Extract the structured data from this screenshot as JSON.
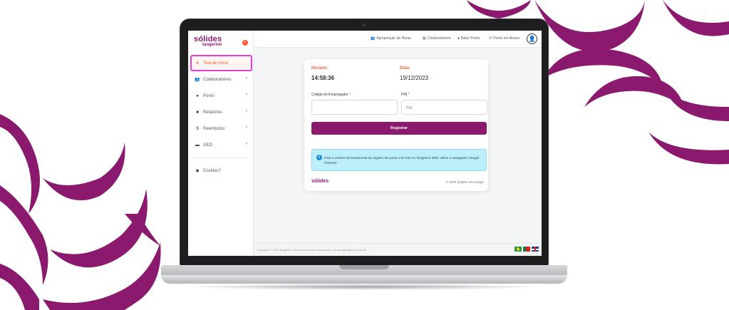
{
  "colors": {
    "brand": "#8b1a6f",
    "accent": "#ff5a36",
    "active_border": "#e53dd8",
    "alert_bg": "#bdeefb",
    "background_wave": "#8b1a6f"
  },
  "sidebar": {
    "logo_main": "sólides",
    "logo_sub": "tangerino",
    "collapse_icon": "chevron-left-icon",
    "items": [
      {
        "label": "Tela de Início",
        "icon": "home-icon",
        "active": true,
        "has_chevron": false
      },
      {
        "label": "Colaboradores",
        "icon": "users-icon",
        "active": false,
        "has_chevron": true
      },
      {
        "label": "Ponto",
        "icon": "clock-icon",
        "active": false,
        "has_chevron": true
      },
      {
        "label": "Relatórios",
        "icon": "document-icon",
        "active": false,
        "has_chevron": true
      },
      {
        "label": "Reembolso",
        "icon": "money-icon",
        "active": false,
        "has_chevron": true
      },
      {
        "label": "GED",
        "icon": "folder-icon",
        "active": false,
        "has_chevron": true
      }
    ],
    "help_label": "Dúvidas?"
  },
  "topbar": {
    "links": [
      {
        "label": "Apropriação de Horas",
        "icon": "people-icon"
      },
      {
        "label": "Colaboradores",
        "icon": "list-icon"
      },
      {
        "label": "Bater Ponto",
        "icon": "clock-icon"
      },
      {
        "label": "Ponto em Atraso",
        "icon": "history-icon"
      }
    ],
    "avatar_icon": "user-icon"
  },
  "card": {
    "time_label": "Horário:",
    "time_value": "14:58:36",
    "date_label": "Data:",
    "date_value": "19/12/2023",
    "employer_code_label": "Código do Empregador",
    "employer_code_value": "",
    "pin_label": "PIN",
    "pin_placeholder": "PIN",
    "required_mark": "*",
    "submit_label": "Registrar",
    "alert_text": "Para o correto funcionamento do registro de ponto com foto no Tangerino Web, utilize o navegador Google Chrome!",
    "footer_logo": "sólides",
    "footer_copyright": "© 2023 Sólides Tecnologia"
  },
  "footer": {
    "text": "Copyright © 2023 Tangerino | Todos os direitos reservados | contato@tangerino.com.br",
    "languages": [
      "pt-BR",
      "pt-PT",
      "en"
    ]
  }
}
